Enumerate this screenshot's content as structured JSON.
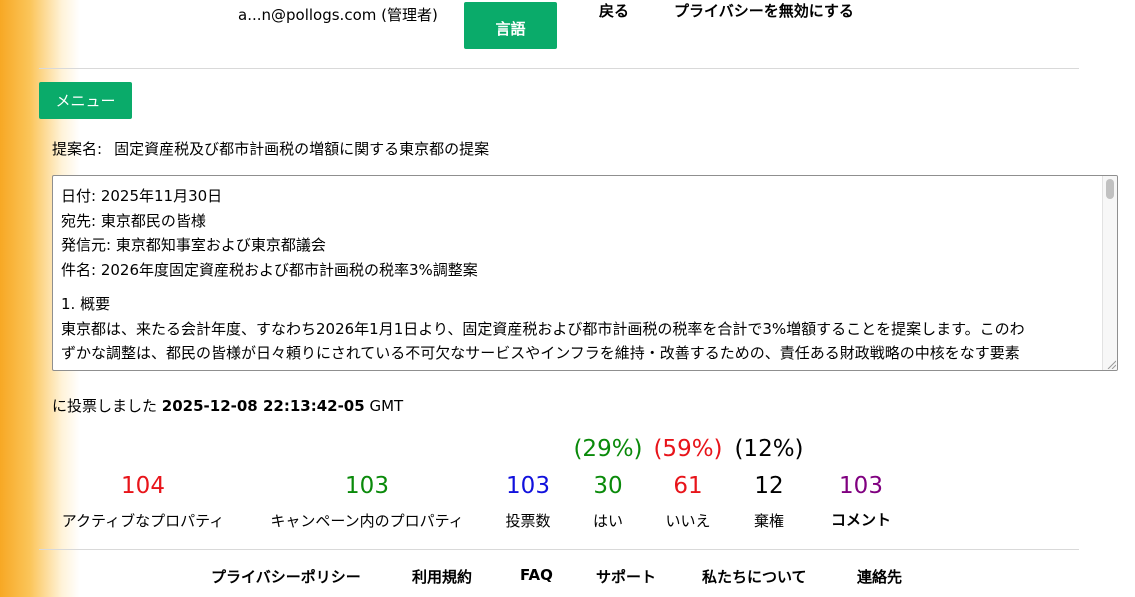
{
  "header": {
    "user": "a...n@pollogs.com (管理者)",
    "language_button": "言語",
    "back_link": "戻る",
    "privacy_toggle_link": "プライバシーを無効にする"
  },
  "menu_button": "メニュー",
  "proposal": {
    "name_prefix": "提案名:",
    "name": "固定資産税及び都市計画税の増額に関する東京都の提案",
    "body_lines": [
      "日付: 2025年11月30日",
      "宛先: 東京都民の皆様",
      "発信元: 東京都知事室および東京都議会",
      "件名: 2026年度固定資産税および都市計画税の税率3%調整案",
      "1. 概要",
      "東京都は、来たる会計年度、すなわち2026年1月1日より、固定資産税および都市計画税の税率を合計で3%増額することを提案します。このわ",
      "ずかな調整は、都民の皆様が日々頼りにされている不可欠なサービスやインフラを維持・改善するための、責任ある財政戦略の中核をなす要素"
    ]
  },
  "vote_status": {
    "prefix": "に投票しました",
    "timestamp": "2025-12-08 22:13:42-05",
    "suffix": "GMT"
  },
  "stats": {
    "active_properties": {
      "value": "104",
      "label": "アクティブなプロパティ",
      "color": "#e8141a"
    },
    "campaign_properties": {
      "value": "103",
      "label": "キャンペーン内のプロパティ",
      "color": "#0a8a0a"
    },
    "votes": {
      "value": "103",
      "label": "投票数",
      "color": "#1111dd"
    },
    "yes": {
      "value": "30",
      "pct": "(29%)",
      "label": "はい",
      "color": "#0a8a0a"
    },
    "no": {
      "value": "61",
      "pct": "(59%)",
      "label": "いいえ",
      "color": "#e8141a"
    },
    "abstain": {
      "value": "12",
      "pct": "(12%)",
      "label": "棄権",
      "color": "#000000"
    },
    "comments": {
      "value": "103",
      "label": "コメント",
      "color": "#800080"
    }
  },
  "footer": {
    "privacy_policy": "プライバシーポリシー",
    "terms": "利用規約",
    "faq": "FAQ",
    "support": "サポート",
    "about": "私たちについて",
    "contact": "連絡先"
  }
}
